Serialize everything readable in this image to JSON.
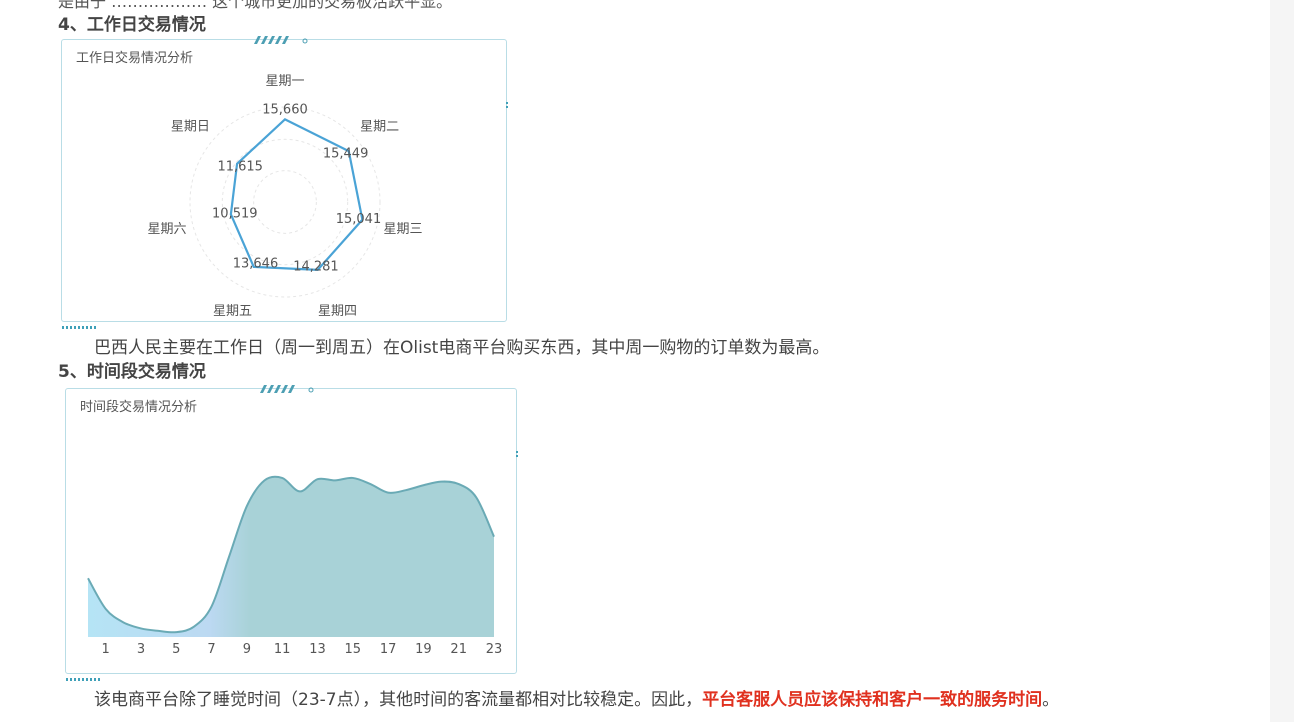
{
  "top_line_partial": "是由于 ……………… 这个城市更加的交易板活跃平显。",
  "section4": {
    "title": "4、工作日交易情况",
    "card_title": "工作日交易情况分析",
    "paragraph": "巴西人民主要在工作日（周一到周五）在Olist电商平台购买东西，其中周一购物的订单数为最高。"
  },
  "section5": {
    "title": "5、时间段交易情况",
    "card_title": "时间段交易情况分析",
    "paragraph_normal": "该电商平台除了睡觉时间（23-7点），其他时间的客流量都相对比较稳定。因此，",
    "paragraph_highlight": "平台客服人员应该保持和客户一致的服务时间",
    "paragraph_end": "。"
  },
  "colors": {
    "line": "#4aa3d6",
    "area_dark": "#a8d2d7",
    "area_light": "#b5e4f5",
    "highlight": "#e0311f",
    "card_border": "#b9dde6"
  },
  "chart_data": [
    {
      "type": "radar",
      "title": "工作日交易情况分析",
      "categories": [
        "星期一",
        "星期二",
        "星期三",
        "星期四",
        "星期五",
        "星期六",
        "星期日"
      ],
      "values": [
        15660,
        15449,
        15041,
        14281,
        13646,
        10519,
        11615
      ],
      "value_labels": [
        "15,660",
        "15,449",
        "15,041",
        "14,281",
        "13,646",
        "10,519",
        "11,615"
      ],
      "range": [
        0,
        18000
      ]
    },
    {
      "type": "area",
      "title": "时间段交易情况分析",
      "x": [
        0,
        1,
        2,
        3,
        4,
        5,
        6,
        7,
        8,
        9,
        10,
        11,
        12,
        13,
        14,
        15,
        16,
        17,
        18,
        19,
        20,
        21,
        22,
        23
      ],
      "tick_labels": [
        "1",
        "3",
        "5",
        "7",
        "9",
        "11",
        "13",
        "15",
        "17",
        "19",
        "21",
        "23"
      ],
      "values": [
        2400,
        1150,
        600,
        350,
        250,
        200,
        420,
        1250,
        3300,
        5350,
        6400,
        6500,
        5950,
        6450,
        6400,
        6500,
        6250,
        5900,
        6000,
        6200,
        6350,
        6250,
        5700,
        4100
      ],
      "ylim": [
        0,
        8500
      ]
    }
  ]
}
